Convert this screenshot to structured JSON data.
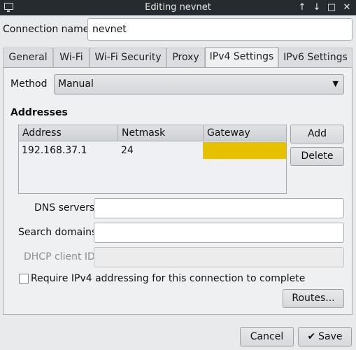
{
  "window": {
    "title": "Editing nevnet"
  },
  "connection": {
    "label": "Connection name",
    "value": "nevnet"
  },
  "tabs": [
    {
      "label": "General"
    },
    {
      "label": "Wi-Fi"
    },
    {
      "label": "Wi-Fi Security"
    },
    {
      "label": "Proxy"
    },
    {
      "label": "IPv4 Settings"
    },
    {
      "label": "IPv6 Settings"
    }
  ],
  "ipv4": {
    "method_label": "Method",
    "method_value": "Manual",
    "addresses_heading": "Addresses",
    "columns": [
      "Address",
      "Netmask",
      "Gateway"
    ],
    "rows": [
      {
        "address": "192.168.37.1",
        "netmask": "24",
        "gateway": ""
      }
    ],
    "add_label": "Add",
    "delete_label": "Delete",
    "dns_label": "DNS servers",
    "dns_value": "",
    "search_label": "Search domains",
    "search_value": "",
    "dhcp_label": "DHCP client ID",
    "dhcp_value": "",
    "require_label": "Require IPv4 addressing for this connection to complete",
    "require_checked": false,
    "routes_label": "Routes..."
  },
  "footer": {
    "cancel_label": "Cancel",
    "save_label": "Save"
  },
  "colors": {
    "gateway_cell_edit": "#e5c100",
    "titlebar": "#262b30"
  }
}
